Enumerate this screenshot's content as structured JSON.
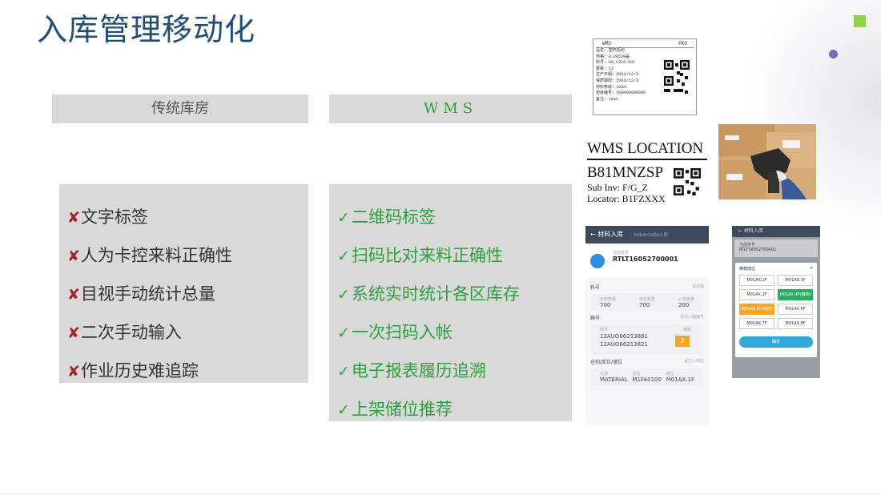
{
  "title": "入库管理移动化",
  "traditional": {
    "header": "传统库房",
    "items": [
      "文字标签",
      "人为卡控来料正确性",
      "目视手动统计总量",
      "二次手动输入",
      "作业历史难追踪"
    ]
  },
  "wms": {
    "header": "WMS",
    "items": [
      "二维码标签",
      "扫码比对来料正确性",
      "系统实时统计各区库存",
      "一次扫码入帐",
      "电子报表履历追溯",
      "上架储位推荐"
    ]
  },
  "label_card": {
    "left_head": "WMS",
    "right_head": "PKG",
    "rows": [
      "品名: 塑料瓶封",
      "规格: 0.00530盖",
      "料号: 66.C3C5.C0C",
      "数量: 12",
      "生产日期: 2018/12/3",
      "保质期限: 2018/12/3",
      "材料等级: XXXX",
      "包装编号: 600000000000",
      "备注: test"
    ]
  },
  "location_label": {
    "title": "WMS  LOCATION",
    "code": "B81MNZSP",
    "sub_inv": "Sub Inv: F/G_Z",
    "locator": "Locator: B1FZXXX"
  },
  "phone1": {
    "title": "材料入库",
    "subtitle": "nobarcode入库",
    "num_label": "当前单号",
    "num_value": "RTLT16052700001",
    "sec1": "料号",
    "sec1_right": "请选择",
    "stats": [
      {
        "label": "未收数量",
        "value": "700"
      },
      {
        "label": "待收数量",
        "value": "700"
      },
      {
        "label": "入库数量",
        "value": "200"
      }
    ],
    "sec2": "箱号",
    "sec2_right": "请扫入箱编号",
    "box_label": "箱号",
    "box_count_label": "箱数",
    "boxes": [
      "12AUO66213881",
      "12AUO66213821"
    ],
    "box_count": "2",
    "sec3": "仓别/库位/储位",
    "sec3_right": "请扫入储位",
    "loc_cols": [
      {
        "label": "仓别",
        "value": "MATERIAL"
      },
      {
        "label": "库位",
        "value": "M1FA0100"
      },
      {
        "label": "储位",
        "value": "M01AX.1F"
      }
    ]
  },
  "phone2": {
    "bar": "材料入库",
    "card_label": "当前单号",
    "card_value": "RTLT16052700001",
    "dialog_title": "推荐储位",
    "cells": [
      "M01AX.1F",
      "M01AX.3F",
      "M01AX.2F",
      "M01AX.4F(推荐)",
      "M01AX.5F(推荐)",
      "M01AX.6F",
      "M01AX.7F",
      "M01AX.8F"
    ],
    "ok": "确定"
  },
  "colors": {
    "title": "#1f4e79",
    "check": "#2e9f3d",
    "cross": "#a4232b",
    "box_bg": "#d9d9d9"
  }
}
